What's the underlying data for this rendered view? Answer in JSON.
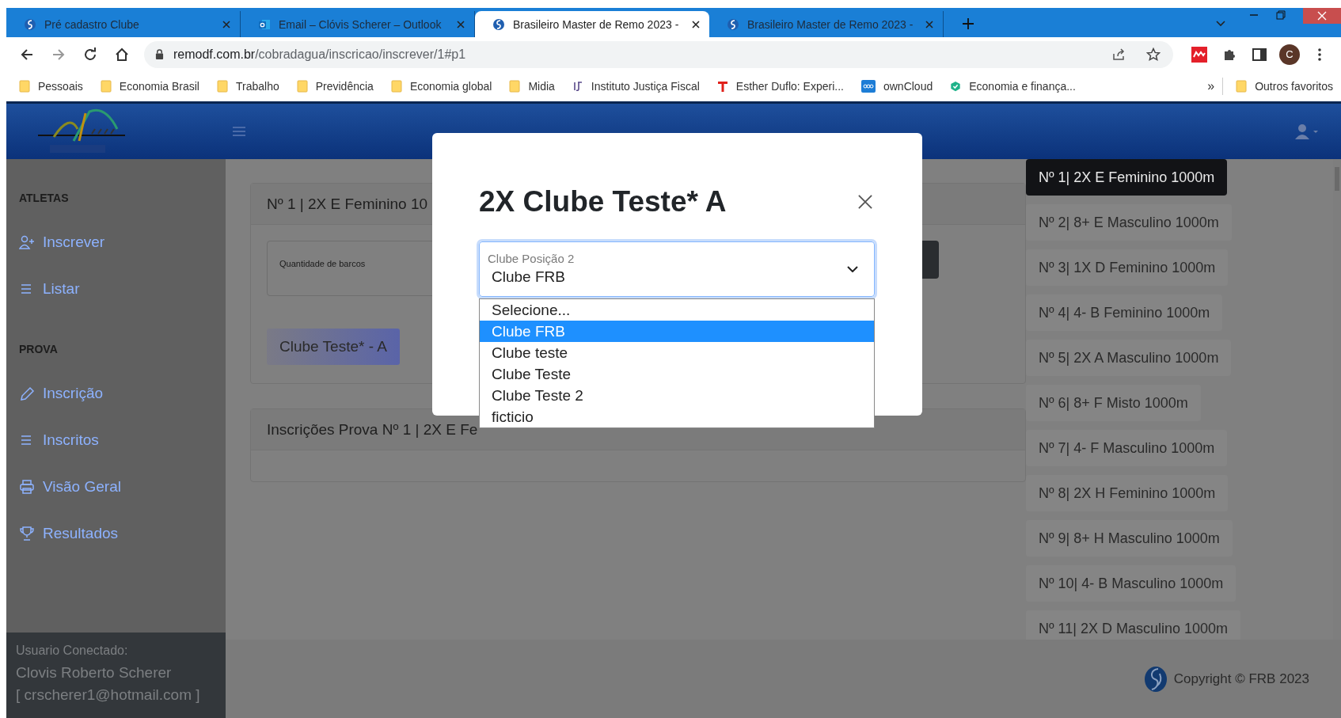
{
  "browser": {
    "tabs": [
      {
        "title": "Pré cadastro Clube",
        "kind": "site",
        "selected": false
      },
      {
        "title": "Email – Clóvis Scherer – Outlook",
        "kind": "mail",
        "selected": false
      },
      {
        "title": "Brasileiro Master de Remo 2023 -",
        "kind": "site",
        "selected": true
      },
      {
        "title": "Brasileiro Master de Remo 2023 -",
        "kind": "site",
        "selected": false
      }
    ],
    "url_host": "remodf.com.br",
    "url_path": "/cobradagua/inscricao/inscrever/1#p1",
    "profile_initial": "C",
    "bookmarks": [
      {
        "label": "Pessoais",
        "kind": "folder"
      },
      {
        "label": "Economia Brasil",
        "kind": "folder"
      },
      {
        "label": "Trabalho",
        "kind": "folder"
      },
      {
        "label": "Previdência",
        "kind": "folder"
      },
      {
        "label": "Economia global",
        "kind": "folder"
      },
      {
        "label": "Midia",
        "kind": "folder"
      },
      {
        "label": "Instituto Justiça Fiscal",
        "kind": "monogram"
      },
      {
        "label": "Esther Duflo: Experi...",
        "kind": "letter"
      },
      {
        "label": "ownCloud",
        "kind": "cloud"
      },
      {
        "label": "Economia e finança...",
        "kind": "shield"
      }
    ],
    "overflow": "»",
    "other_bookmarks": "Outros favoritos"
  },
  "sidebar": {
    "sections": [
      {
        "title": "ATLETAS",
        "items": [
          {
            "label": "Inscrever",
            "kind": "add-user"
          },
          {
            "label": "Listar",
            "kind": "list"
          }
        ]
      },
      {
        "title": "PROVA",
        "items": [
          {
            "label": "Inscrição",
            "kind": "edit"
          },
          {
            "label": "Inscritos",
            "kind": "list"
          },
          {
            "label": "Visão Geral",
            "kind": "print"
          },
          {
            "label": "Resultados",
            "kind": "trophy"
          }
        ]
      }
    ],
    "user": {
      "caption": "Usuario Conectado:",
      "name": "Clovis Roberto Scherer",
      "email": "[ crscherer1@hotmail.com ]"
    }
  },
  "main": {
    "event_title": "Nº 1 | 2X E Feminino 10",
    "quantity_label": "Quantidade de barcos",
    "boat_button": "Clube Teste* - A",
    "entries_title": "Inscrições Prova Nº 1 | 2X E Fe"
  },
  "modal": {
    "title": "2X Clube Teste* A",
    "select": {
      "label": "Clube Posição 2",
      "value": "Clube FRB",
      "options": [
        {
          "label": "Selecione...",
          "selected": false
        },
        {
          "label": "Clube FRB",
          "selected": true
        },
        {
          "label": "Clube teste",
          "selected": false
        },
        {
          "label": "Clube Teste",
          "selected": false
        },
        {
          "label": "Clube Teste 2",
          "selected": false
        },
        {
          "label": "ficticio",
          "selected": false
        }
      ]
    }
  },
  "events": [
    {
      "label": "Nº 1| 2X E Feminino 1000m",
      "selected": true
    },
    {
      "label": "Nº 2| 8+ E Masculino 1000m",
      "selected": false
    },
    {
      "label": "Nº 3| 1X D Feminino 1000m",
      "selected": false
    },
    {
      "label": "Nº 4| 4- B Feminino 1000m",
      "selected": false
    },
    {
      "label": "Nº 5| 2X A Masculino 1000m",
      "selected": false
    },
    {
      "label": "Nº 6| 8+ F Misto 1000m",
      "selected": false
    },
    {
      "label": "Nº 7| 4- F Masculino 1000m",
      "selected": false
    },
    {
      "label": "Nº 8| 2X H Feminino 1000m",
      "selected": false
    },
    {
      "label": "Nº 9| 8+ H Masculino 1000m",
      "selected": false
    },
    {
      "label": "Nº 10| 4- B Masculino 1000m",
      "selected": false
    },
    {
      "label": "Nº 11| 2X D Masculino 1000m",
      "selected": false
    }
  ],
  "footer": {
    "copyright": "Copyright © FRB 2023"
  }
}
